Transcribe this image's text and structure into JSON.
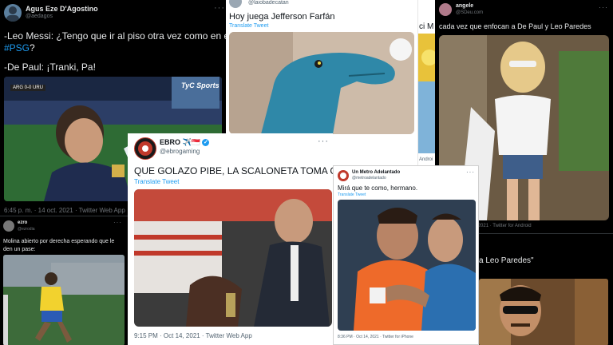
{
  "tweet_messi": {
    "name": "Agus Eze D'Agostino",
    "handle": "@aedagos",
    "line1": "-Leo Messi: ¿Tengo que ir al piso otra vez como en el",
    "hashtag": "#PSG",
    "line2_end": "?",
    "line3": "-De Paul: ¡Tranki, Pa!",
    "score": "ARG 0-0 URU",
    "channel": "TyC Sports",
    "footer": "6:45 p. m. · 14 oct. 2021 · Twitter Web App"
  },
  "tweet_farfan": {
    "handle": "@laiobadecatan",
    "text": "Hoy juega Jefferson Farfán",
    "translate": "Translate Tweet"
  },
  "tweet_partial_mid": {
    "text_fragment": "ci M",
    "footer_fragment": "Androi"
  },
  "tweet_angele": {
    "name": "angele",
    "handle": "@SDeu.com",
    "text": "cada vez que enfocan a De Paul y Leo Paredes",
    "footer": "5:21 PM · Oct 15, 2021 · Twitter for Android"
  },
  "tweet_neymar": {
    "name": "ezro",
    "handle": "@ezrodia",
    "text": "Molina abierto por derecha esperando que le den un pase:"
  },
  "tweet_ebro": {
    "name": "EBRO",
    "emoji": "✈️🇸🇬",
    "handle": "@ebrogaming",
    "text": "QUE GOLAZO PIBE, LA SCALONETA TOMA G",
    "translate": "Translate Tweet",
    "footer": "9:15 PM · Oct 14, 2021 · Twitter Web App"
  },
  "tweet_metro": {
    "name": "Un Metro Adelantado",
    "handle": "@metroadelantado",
    "text": "Mirá que te como, hermano.",
    "translate": "Translate Tweet",
    "footer": "8:36 PM · Oct 14, 2021 · Twitter for iPhone"
  },
  "tweet_paredes": {
    "text_fragment": "a Leo Paredes\""
  },
  "more_glyph": "···"
}
